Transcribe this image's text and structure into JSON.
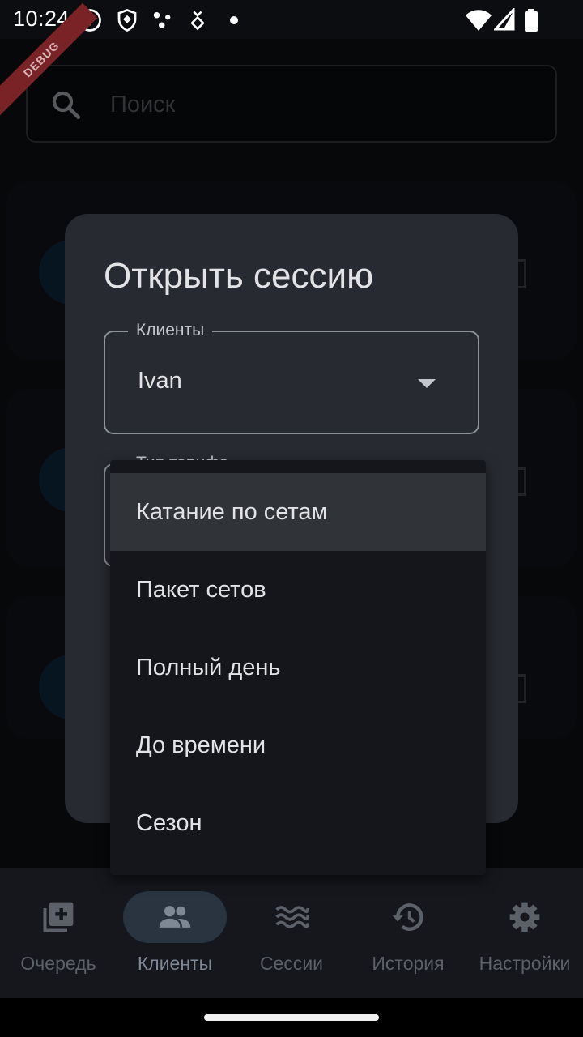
{
  "status_bar": {
    "time": "10:24",
    "left_icons": [
      "info-icon",
      "shield-icon",
      "dots-icon",
      "download-icon",
      "dot-icon"
    ],
    "right_icons": [
      "wifi-icon",
      "signal-icon",
      "battery-icon"
    ]
  },
  "debug_banner": "DEBUG",
  "search": {
    "placeholder": "Поиск",
    "value": ""
  },
  "dialog": {
    "title": "Открыть сессию",
    "client_field": {
      "label": "Клиенты",
      "value": "Ivan"
    },
    "tariff_field": {
      "label": "Тип тарифа"
    }
  },
  "tariff_menu": {
    "selected_index": 0,
    "items": [
      {
        "label": "Катание по сетам"
      },
      {
        "label": "Пакет сетов"
      },
      {
        "label": "Полный день"
      },
      {
        "label": "До времени"
      },
      {
        "label": "Сезон"
      }
    ]
  },
  "bottom_nav": {
    "active": 1,
    "items": [
      {
        "label": "Очередь",
        "icon": "queue-add-icon"
      },
      {
        "label": "Клиенты",
        "icon": "people-icon"
      },
      {
        "label": "Сессии",
        "icon": "waves-icon"
      },
      {
        "label": "История",
        "icon": "history-icon"
      },
      {
        "label": "Настройки",
        "icon": "gear-icon"
      }
    ]
  },
  "colors": {
    "background": "#111318",
    "dialog": "#272a30",
    "menu": "#14161b",
    "menu_selected": "#303338",
    "nav_active_pill": "#2a3340",
    "debug_banner": "#7a2327"
  }
}
